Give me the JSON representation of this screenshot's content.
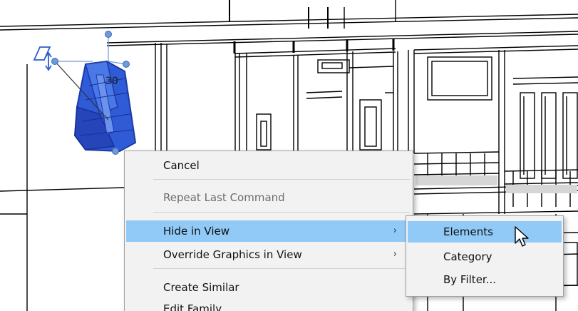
{
  "viewport": {
    "element_tag": "30",
    "selection_color": "#2f5bd6",
    "selection_dark": "#1d3aa8",
    "grip_color": "#6f9ad8"
  },
  "context_menu": {
    "items": [
      {
        "label": "Cancel",
        "enabled": true
      },
      {
        "label": "Repeat Last Command",
        "enabled": false
      },
      {
        "label": "Hide in View",
        "submenu": true,
        "highlighted": true
      },
      {
        "label": "Override Graphics in View",
        "submenu": true
      },
      {
        "label": "Create Similar",
        "enabled": true
      },
      {
        "label": "Edit Family",
        "enabled": true
      }
    ],
    "highlight_color": "#91c9f7",
    "submenu_arrow": "›"
  },
  "submenu": {
    "items": [
      {
        "label": "Elements",
        "highlighted": true
      },
      {
        "label": "Category"
      },
      {
        "label": "By Filter..."
      }
    ]
  },
  "cursor": {
    "icon": "arrow-cursor-icon"
  }
}
